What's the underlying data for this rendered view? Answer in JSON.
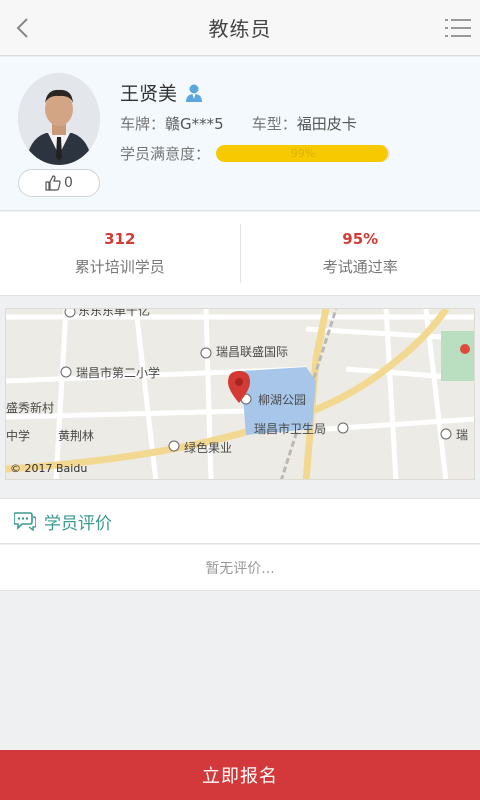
{
  "header": {
    "title": "教练员"
  },
  "coach": {
    "name": "王贤美",
    "likes": "0",
    "plate_label": "车牌：",
    "plate_value": "赣G***5",
    "car_label": "车型：",
    "car_value": "福田皮卡",
    "satisfaction_label": "学员满意度：",
    "satisfaction_text": "99%",
    "satisfaction_percent": 99
  },
  "stats": [
    {
      "value": "312",
      "label": "累计培训学员"
    },
    {
      "value": "95%",
      "label": "考试通过率"
    }
  ],
  "map": {
    "labels": [
      "东东东单千亿",
      "瑞昌联盛国际",
      "瑞昌市第二小学",
      "柳湖公园",
      "盛秀新村",
      "瑞昌市卫生局",
      "中学",
      "黄荆林",
      "绿色果业",
      "瑞"
    ],
    "copyright": "© 2017 Baidu"
  },
  "reviews": {
    "title": "学员评价",
    "empty_text": "暂无评价..."
  },
  "actions": {
    "signup_label": "立即报名"
  },
  "colors": {
    "accent_red": "#d3393a",
    "stat_red": "#d43b35",
    "teal": "#3a9a8f",
    "bar_yellow": "#f7c900"
  }
}
